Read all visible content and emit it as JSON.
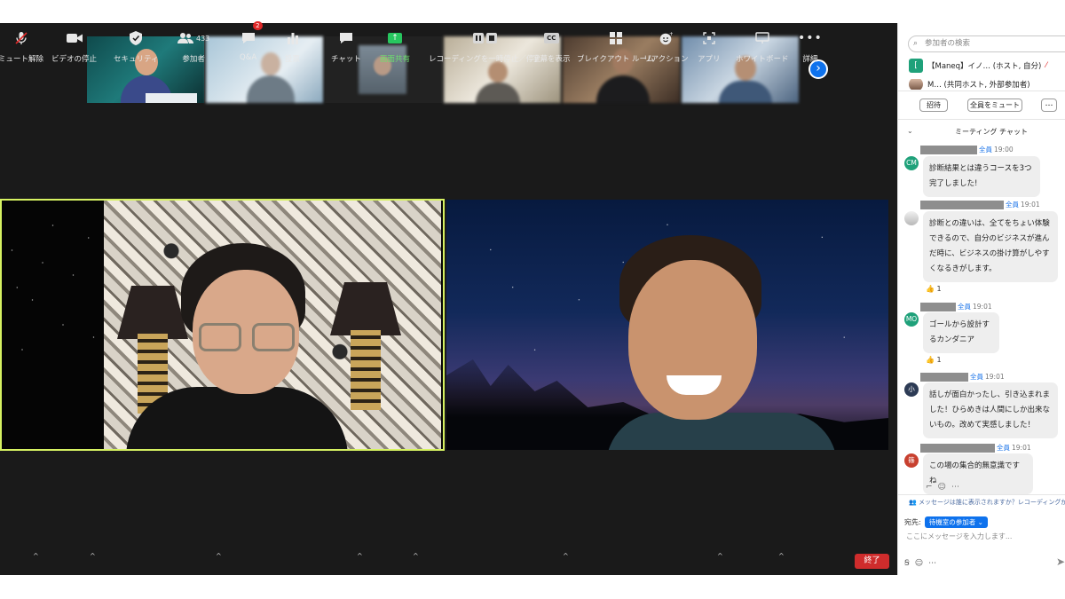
{
  "thumbnails": [
    "thumb-1",
    "thumb-2",
    "thumb-3",
    "thumb-4",
    "thumb-5",
    "thumb-6"
  ],
  "colors": {
    "accent_blue": "#0e72ed",
    "active_speaker_border": "#d6f262",
    "end_red": "#cf2c2c",
    "share_green": "#27c65f",
    "chat_bubble": "#eeeeee"
  },
  "toolbar": {
    "mute": "ミュート解除",
    "video": "ビデオの停止",
    "security": "セキュリティ",
    "participants": "参加者",
    "participants_count": "433",
    "qa": "Q&A",
    "qa_badge": "2",
    "polls": "投票",
    "chat": "チャット",
    "share": "画面共有",
    "recording": "レコーディングを一時停止／停止",
    "captions": "字幕を表示",
    "captions_icon": "CC",
    "breakout": "ブレイクアウト ルーム",
    "reactions": "リアクション",
    "apps": "アプリ",
    "whiteboard": "ホワイトボード",
    "more": "詳細",
    "end": "終了"
  },
  "panel": {
    "search_placeholder": "参加者の検索",
    "participant_1": "【Maneq】イノ… (ホスト, 自分)",
    "participant_1_avatar": "[",
    "participant_2": "M… (共同ホスト, 外部参加者)",
    "invite": "招待",
    "mute_all": "全員をミュート",
    "more": "…",
    "chat_title": "ミーティング チャット",
    "messages": [
      {
        "avatar": "CM",
        "avatar_color": "#1fa17a",
        "to": "全員",
        "time": "19:00",
        "text": "診断結果とは違うコースを3つ完了しました!"
      },
      {
        "avatar": "",
        "avatar_color": "#d9d9d9",
        "to": "全員",
        "time": "19:01",
        "text": "診断との違いは、全てをちょい体験できるので、自分のビジネスが進んだ時に、ビジネスの掛け算がしやすくなるきがします。",
        "reaction": "👍 1"
      },
      {
        "avatar": "MO",
        "avatar_color": "#1fa17a",
        "to": "全員",
        "time": "19:01",
        "text": "ゴールから設計するカンダニア",
        "reaction": "👍 1"
      },
      {
        "avatar": "小",
        "avatar_color": "#2d3b55",
        "to": "全員",
        "time": "19:01",
        "text": "話しが面白かったし、引き込まれました！ひらめきは人間にしか出来ないもの。改めて実感しました！"
      },
      {
        "avatar": "篠",
        "avatar_color": "#c8402f",
        "to": "全員",
        "time": "19:01",
        "text": "この場の集合的無意識ですね"
      }
    ],
    "visibility_note": "メッセージは誰に表示されますか？レコーディングが有効",
    "to_label": "宛先:",
    "to_value": "待機室の参加者",
    "input_placeholder": "ここにメッセージを入力します..."
  }
}
